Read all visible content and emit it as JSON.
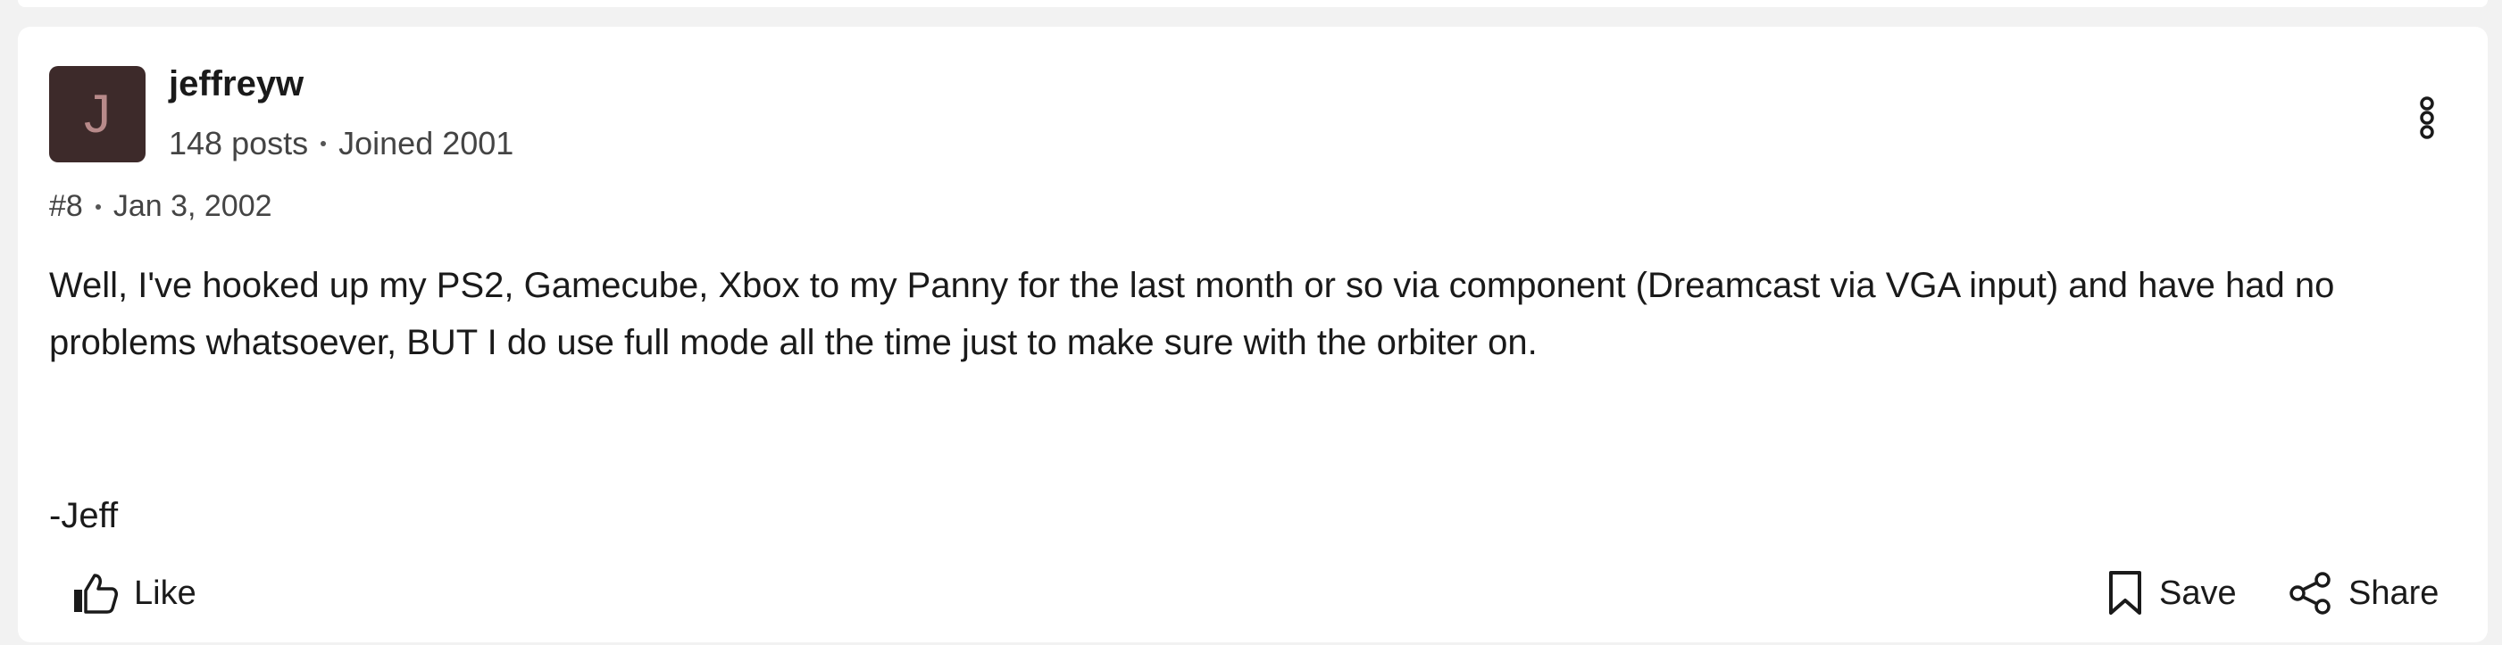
{
  "post": {
    "author": {
      "avatar_letter": "J",
      "avatar_bg": "#3d2a2a",
      "username": "jeffreyw",
      "posts_count": "148 posts",
      "joined": "Joined 2001"
    },
    "number": "#8",
    "date": "Jan 3, 2002",
    "body": "Well, I've hooked up my PS2, Gamecube, Xbox to my Panny for the last month or so via component (Dreamcast via VGA input) and have had no problems whatsoever, BUT I do use full mode all the time just to make sure with the orbiter on.",
    "signature": "-Jeff"
  },
  "actions": {
    "like_label": "Like",
    "save_label": "Save",
    "share_label": "Share",
    "more_icon": "kebab-menu-icon"
  }
}
